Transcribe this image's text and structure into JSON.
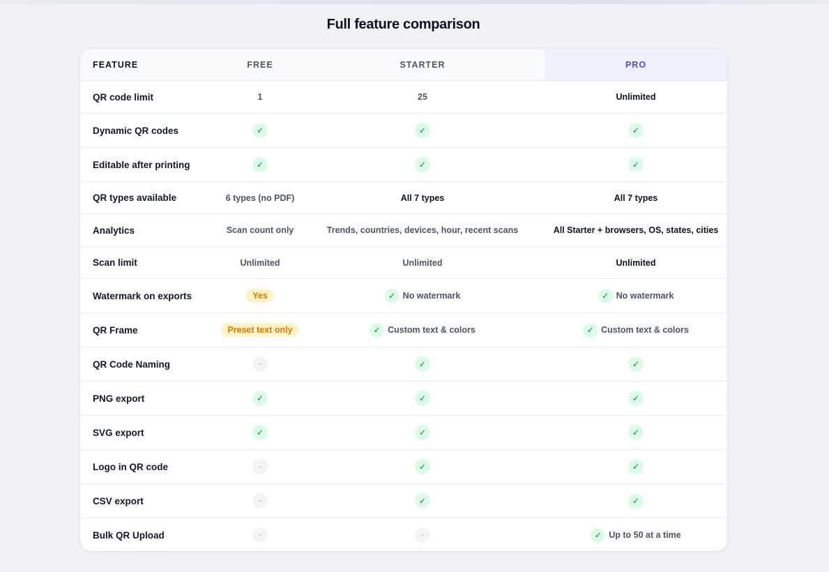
{
  "title": "Full feature comparison",
  "columns": {
    "feature": "FEATURE",
    "free": "FREE",
    "starter": "STARTER",
    "pro": "PRO"
  },
  "rows": [
    {
      "feature": "QR code limit",
      "free": {
        "kind": "text",
        "text": "1"
      },
      "starter": {
        "kind": "text",
        "text": "25"
      },
      "pro": {
        "kind": "text",
        "text": "Unlimited",
        "strong": true
      }
    },
    {
      "feature": "Dynamic QR codes",
      "free": {
        "kind": "check"
      },
      "starter": {
        "kind": "check"
      },
      "pro": {
        "kind": "check"
      }
    },
    {
      "feature": "Editable after printing",
      "free": {
        "kind": "check"
      },
      "starter": {
        "kind": "check"
      },
      "pro": {
        "kind": "check"
      }
    },
    {
      "feature": "QR types available",
      "free": {
        "kind": "text",
        "text": "6 types (no PDF)"
      },
      "starter": {
        "kind": "text",
        "text": "All 7 types",
        "strong": true
      },
      "pro": {
        "kind": "text",
        "text": "All 7 types",
        "strong": true
      }
    },
    {
      "feature": "Analytics",
      "free": {
        "kind": "text",
        "text": "Scan count only"
      },
      "starter": {
        "kind": "text",
        "text": "Trends, countries, devices, hour, recent scans"
      },
      "pro": {
        "kind": "text",
        "text": "All Starter + browsers, OS, states, cities",
        "strong": true
      }
    },
    {
      "feature": "Scan limit",
      "free": {
        "kind": "text",
        "text": "Unlimited"
      },
      "starter": {
        "kind": "text",
        "text": "Unlimited"
      },
      "pro": {
        "kind": "text",
        "text": "Unlimited",
        "strong": true
      }
    },
    {
      "feature": "Watermark on exports",
      "free": {
        "kind": "pill",
        "text": "Yes"
      },
      "starter": {
        "kind": "check-text",
        "text": "No watermark"
      },
      "pro": {
        "kind": "check-text",
        "text": "No watermark"
      }
    },
    {
      "feature": "QR Frame",
      "free": {
        "kind": "pill",
        "text": "Preset text only"
      },
      "starter": {
        "kind": "check-text",
        "text": "Custom text & colors"
      },
      "pro": {
        "kind": "check-text",
        "text": "Custom text & colors"
      }
    },
    {
      "feature": "QR Code Naming",
      "free": {
        "kind": "dash"
      },
      "starter": {
        "kind": "check"
      },
      "pro": {
        "kind": "check"
      }
    },
    {
      "feature": "PNG export",
      "free": {
        "kind": "check"
      },
      "starter": {
        "kind": "check"
      },
      "pro": {
        "kind": "check"
      }
    },
    {
      "feature": "SVG export",
      "free": {
        "kind": "check"
      },
      "starter": {
        "kind": "check"
      },
      "pro": {
        "kind": "check"
      }
    },
    {
      "feature": "Logo in QR code",
      "free": {
        "kind": "dash"
      },
      "starter": {
        "kind": "check"
      },
      "pro": {
        "kind": "check"
      }
    },
    {
      "feature": "CSV export",
      "free": {
        "kind": "dash"
      },
      "starter": {
        "kind": "check"
      },
      "pro": {
        "kind": "check"
      }
    },
    {
      "feature": "Bulk QR Upload",
      "free": {
        "kind": "dash"
      },
      "starter": {
        "kind": "dash"
      },
      "pro": {
        "kind": "check-text",
        "text": "Up to 50 at a time"
      }
    }
  ],
  "icons": {
    "check": "✓",
    "dash": "–"
  },
  "colors": {
    "accent": "#4f46e5",
    "pro_header_bg": "#eef1fd",
    "check_bg": "#dcfce7",
    "check_fg": "#15803d",
    "pill_bg": "#fef3c7",
    "pill_fg": "#d97706"
  }
}
